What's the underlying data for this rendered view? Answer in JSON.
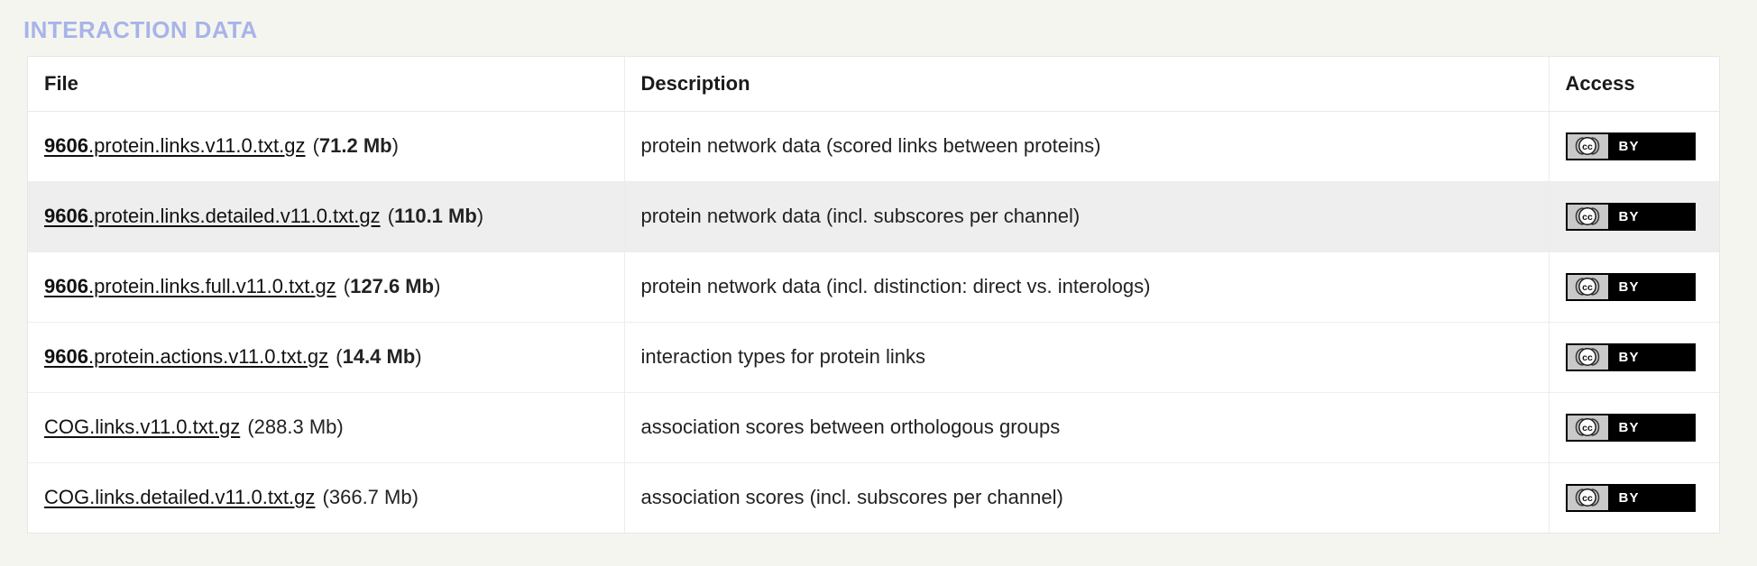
{
  "section": {
    "title": "INTERACTION DATA"
  },
  "table": {
    "columns": [
      {
        "key": "file",
        "label": "File"
      },
      {
        "key": "description",
        "label": "Description"
      },
      {
        "key": "access",
        "label": "Access"
      }
    ],
    "rows": [
      {
        "file_prefix": "9606",
        "file_rest": ".protein.links.v11.0.txt.gz",
        "size_open": " (",
        "size_value": "71.2 Mb",
        "size_close": ")",
        "size_bold": true,
        "description": "protein network data (scored links between proteins)",
        "access_badge": "cc-by-icon",
        "access_label": "BY",
        "highlighted": false
      },
      {
        "file_prefix": "9606",
        "file_rest": ".protein.links.detailed.v11.0.txt.gz",
        "size_open": " (",
        "size_value": "110.1 Mb",
        "size_close": ")",
        "size_bold": true,
        "description": "protein network data (incl. subscores per channel)",
        "access_badge": "cc-by-icon",
        "access_label": "BY",
        "highlighted": true
      },
      {
        "file_prefix": "9606",
        "file_rest": ".protein.links.full.v11.0.txt.gz",
        "size_open": " (",
        "size_value": "127.6 Mb",
        "size_close": ")",
        "size_bold": true,
        "description": "protein network data (incl. distinction: direct vs. interologs)",
        "access_badge": "cc-by-icon",
        "access_label": "BY",
        "highlighted": false
      },
      {
        "file_prefix": "9606",
        "file_rest": ".protein.actions.v11.0.txt.gz",
        "size_open": " (",
        "size_value": "14.4 Mb",
        "size_close": ")",
        "size_bold": true,
        "description": "interaction types for protein links",
        "access_badge": "cc-by-icon",
        "access_label": "BY",
        "highlighted": false
      },
      {
        "file_prefix": "",
        "file_rest": "COG.links.v11.0.txt.gz",
        "size_open": " (",
        "size_value": "288.3 Mb",
        "size_close": ")",
        "size_bold": false,
        "description": "association scores between orthologous groups",
        "access_badge": "cc-by-icon",
        "access_label": "BY",
        "highlighted": false
      },
      {
        "file_prefix": "",
        "file_rest": "COG.links.detailed.v11.0.txt.gz",
        "size_open": " (",
        "size_value": "366.7 Mb",
        "size_close": ")",
        "size_bold": false,
        "description": "association scores (incl. subscores per channel)",
        "access_badge": "cc-by-icon",
        "access_label": "BY",
        "highlighted": false
      }
    ]
  },
  "colors": {
    "page_background": "#f5f5f0",
    "title": "#a8b4e8",
    "table_background": "#ffffff",
    "row_highlight": "#eeeeee",
    "text": "#222222",
    "badge_background": "#000000",
    "badge_mark_background": "#c9c9c9"
  }
}
